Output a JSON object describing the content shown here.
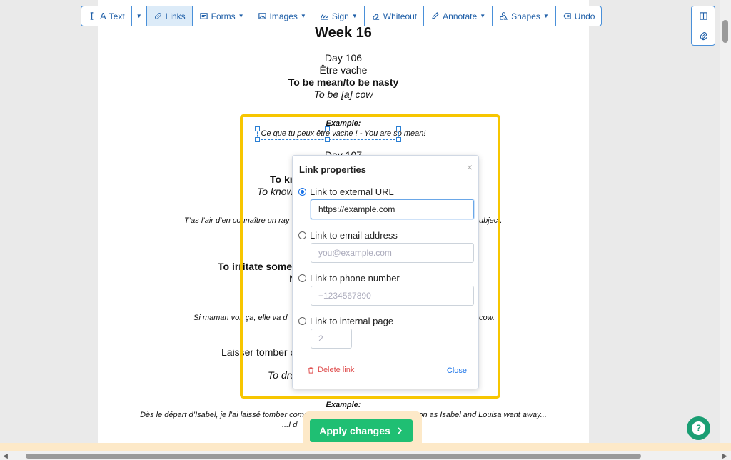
{
  "toolbar": {
    "text_label": "Text",
    "links_label": "Links",
    "forms_label": "Forms",
    "images_label": "Images",
    "sign_label": "Sign",
    "whiteout_label": "Whiteout",
    "annotate_label": "Annotate",
    "shapes_label": "Shapes",
    "undo_label": "Undo"
  },
  "document": {
    "week_title": "Week 16",
    "day106": {
      "day": "Day 106",
      "french": "Être vache",
      "english": "To be mean/to be nasty",
      "literal": "To be [a] cow",
      "example_label": "Example:",
      "example_text": "Ce que tu peux être vache ! - You are so mean!"
    },
    "day107": {
      "day": "Day 107",
      "english_partial": "To kn",
      "literal_partial": "To know",
      "example_partial_left": "T’as l’air d’en connaître un ray",
      "example_partial_right": "ubject."
    },
    "day108": {
      "english_partial": "To irritate somec",
      "line_partial": "N",
      "example_partial_left": "Si maman voit ça, elle va d",
      "example_partial_right": "cow."
    },
    "day109": {
      "french_partial": "Laisser tomber c",
      "literal_partial": "To dro",
      "example_label": "Example:",
      "example_text": "Dès le départ d’Isabel, je l’ai laissé tomber comme une vieille chaussette - As soon as Isabel and Louisa went away...",
      "example_text2": "...I d"
    }
  },
  "popup": {
    "title": "Link properties",
    "close_x": "×",
    "options": {
      "external_label": "Link to external URL",
      "external_value": "https://example.com",
      "email_label": "Link to email address",
      "email_placeholder": "you@example.com",
      "phone_label": "Link to phone number",
      "phone_placeholder": "+1234567890",
      "internal_label": "Link to internal page",
      "internal_placeholder": "2"
    },
    "delete_label": "Delete link",
    "close_label": "Close"
  },
  "apply_label": "Apply changes",
  "help_label": "?",
  "colors": {
    "accent": "#1f5fa8",
    "highlight": "#f7c600",
    "apply": "#1fbf73",
    "help": "#1a9e73",
    "delete": "#e05252"
  }
}
